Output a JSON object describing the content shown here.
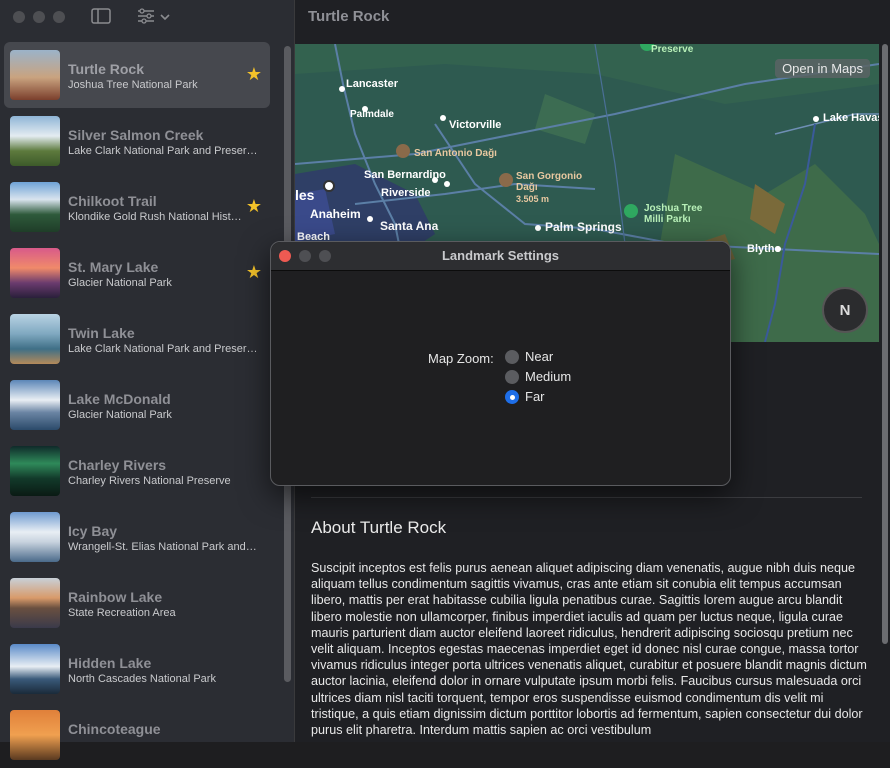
{
  "window": {
    "toolbar_icons": [
      "sidebar-toggle-icon",
      "filter-icon",
      "chevron-down-icon"
    ]
  },
  "sidebar": {
    "items": [
      {
        "title": "Turtle Rock",
        "subtitle": "Joshua Tree National Park",
        "favorite": true,
        "selected": true
      },
      {
        "title": "Silver Salmon Creek",
        "subtitle": "Lake Clark National Park and Preserve",
        "favorite": false
      },
      {
        "title": "Chilkoot Trail",
        "subtitle": "Klondike Gold Rush National Hist…",
        "favorite": true
      },
      {
        "title": "St. Mary Lake",
        "subtitle": "Glacier National Park",
        "favorite": true
      },
      {
        "title": "Twin Lake",
        "subtitle": "Lake Clark National Park and Preserve",
        "favorite": false
      },
      {
        "title": "Lake McDonald",
        "subtitle": "Glacier National Park",
        "favorite": false
      },
      {
        "title": "Charley Rivers",
        "subtitle": "Charley Rivers National Preserve",
        "favorite": false
      },
      {
        "title": "Icy Bay",
        "subtitle": "Wrangell-St. Elias National Park and…",
        "favorite": false
      },
      {
        "title": "Rainbow Lake",
        "subtitle": "State Recreation Area",
        "favorite": false
      },
      {
        "title": "Hidden Lake",
        "subtitle": "North Cascades National Park",
        "favorite": false
      },
      {
        "title": "Chincoteague",
        "subtitle": "",
        "favorite": false
      }
    ],
    "star_glyph": "★"
  },
  "main": {
    "title": "Turtle Rock",
    "open_in_maps": "Open in Maps",
    "compass": "N",
    "map_labels": {
      "preserve": "Preserve",
      "lancaster": "Lancaster",
      "palmdale": "Palmdale",
      "victorville": "Victorville",
      "lake_havasu": "Lake Havas",
      "san_antonio": "San Antonio Dağı",
      "san_bernardino": "San Bernardino",
      "san_gorgonio": "San Gorgonio",
      "dagi": "Dağı",
      "elevation": "3.505 m",
      "riverside": "Riverside",
      "les": "les",
      "anaheim": "Anaheim",
      "santa_ana": "Santa Ana",
      "beach": "Beach",
      "palm_springs": "Palm Springs",
      "joshua_tree": "Joshua Tree",
      "milli_parki": "Milli Parkı",
      "blythe": "Blythe"
    },
    "about_title": "About Turtle Rock",
    "about_text": "Suscipit inceptos est felis purus aenean aliquet adipiscing diam venenatis, augue nibh duis neque aliquam tellus condimentum sagittis vivamus, cras ante etiam sit conubia elit tempus accumsan libero, mattis per erat habitasse cubilia ligula penatibus curae. Sagittis lorem augue arcu blandit libero molestie non ullamcorper, finibus imperdiet iaculis ad quam per luctus neque, ligula curae mauris parturient diam auctor eleifend laoreet ridiculus, hendrerit adipiscing sociosqu pretium nec velit aliquam. Inceptos egestas maecenas imperdiet eget id donec nisl curae congue, massa tortor vivamus ridiculus integer porta ultrices venenatis aliquet, curabitur et posuere blandit magnis dictum auctor lacinia, eleifend dolor in ornare vulputate ipsum morbi felis. Faucibus cursus malesuada orci ultrices diam nisl taciti torquent, tempor eros suspendisse euismod condimentum dis velit mi tristique, a quis etiam dignissim dictum porttitor lobortis ad fermentum, sapien consectetur dui dolor purus elit pharetra. Interdum mattis sapien ac orci vestibulum"
  },
  "dialog": {
    "title": "Landmark Settings",
    "zoom_label": "Map Zoom:",
    "options": [
      {
        "label": "Near",
        "selected": false
      },
      {
        "label": "Medium",
        "selected": false
      },
      {
        "label": "Far",
        "selected": true
      }
    ]
  },
  "colors": {
    "accent": "#1e6ee8",
    "star": "#f3c22a",
    "close_button": "#ee5a52"
  }
}
